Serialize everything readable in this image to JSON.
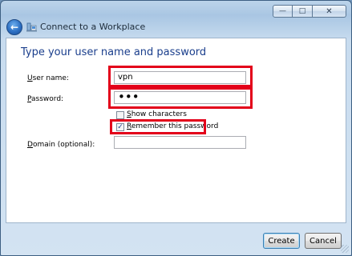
{
  "window": {
    "title": "Connect to a Workplace",
    "buttons": {
      "minimize": "—",
      "maximize": "□",
      "close": "✕"
    }
  },
  "nav": {
    "back_icon": "arrow-left-icon"
  },
  "page": {
    "heading": "Type your user name and password"
  },
  "form": {
    "username": {
      "label_accel": "U",
      "label_rest": "ser name:",
      "value": "vpn"
    },
    "password": {
      "label_accel": "P",
      "label_rest": "assword:",
      "value": "•••"
    },
    "show_characters": {
      "label_accel": "S",
      "label_rest": "how characters",
      "checked": false
    },
    "remember_password": {
      "label_accel": "R",
      "label_rest": "emember this password",
      "checked": true,
      "check_glyph": "✓"
    },
    "domain": {
      "label_accel": "D",
      "label_rest": "omain (optional):",
      "value": ""
    }
  },
  "footer": {
    "create_label": "Create",
    "cancel_label": "Cancel"
  },
  "colors": {
    "highlight": "#e3001a",
    "heading": "#1a3e8c",
    "frame": "#a9c6e3"
  }
}
